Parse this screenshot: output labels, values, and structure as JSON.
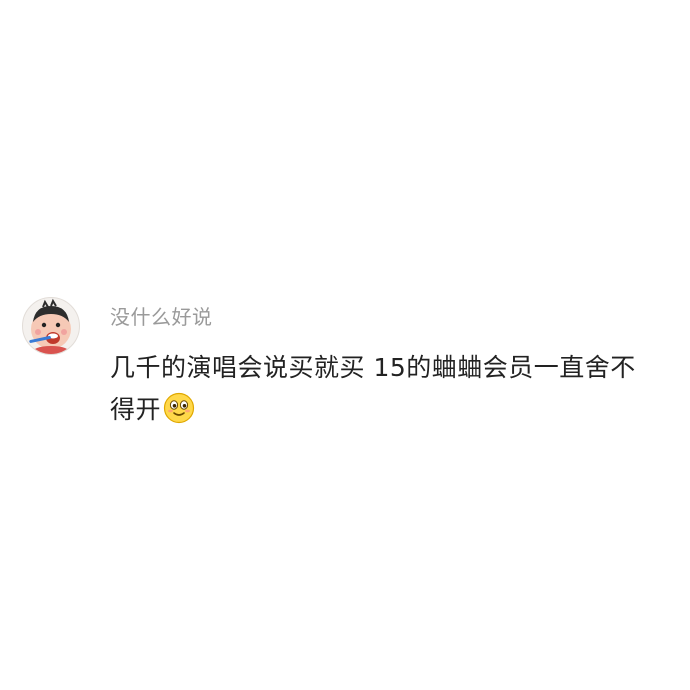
{
  "comment": {
    "username": "没什么好说",
    "text": "几千的演唱会说买就买 15的蛐蛐会员一直舍不得开",
    "emoji": "smiley-emoji-icon",
    "avatar": "cartoon-boy-toothbrush-avatar"
  },
  "colors": {
    "username": "#9a9a9a",
    "text": "#222222",
    "background": "#ffffff"
  }
}
